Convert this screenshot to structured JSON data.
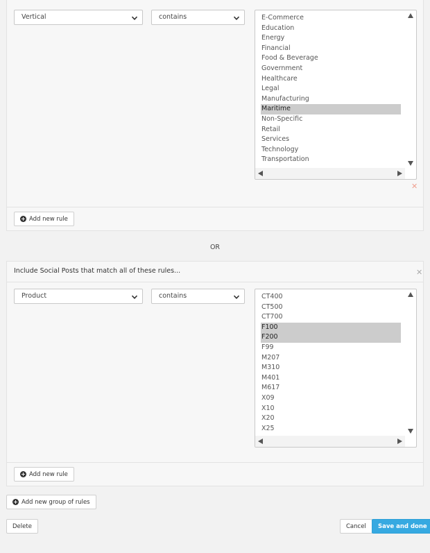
{
  "group1": {
    "rule": {
      "field": "Vertical",
      "operator": "contains",
      "options": [
        "E-Commerce",
        "Education",
        "Energy",
        "Financial",
        "Food & Beverage",
        "Government",
        "Healthcare",
        "Legal",
        "Manufacturing",
        "Maritime",
        "Non-Specific",
        "Retail",
        "Services",
        "Technology",
        "Transportation"
      ],
      "selected": [
        "Maritime"
      ],
      "remove_rule_icon": "close-icon"
    },
    "add_rule_label": "Add new rule"
  },
  "or_label": "OR",
  "group2": {
    "title": "Include Social Posts that match all of these rules...",
    "remove_group_icon": "close-icon",
    "rule": {
      "field": "Product",
      "operator": "contains",
      "options": [
        "CT400",
        "CT500",
        "CT700",
        "F100",
        "F200",
        "F99",
        "M207",
        "M310",
        "M401",
        "M617",
        "X09",
        "X10",
        "X20",
        "X25"
      ],
      "selected": [
        "F100",
        "F200"
      ]
    },
    "add_rule_label": "Add new rule"
  },
  "add_group_label": "Add new group of rules",
  "footer": {
    "delete_label": "Delete",
    "cancel_label": "Cancel",
    "save_label": "Save and done"
  },
  "colors": {
    "primary": "#36a9e1",
    "selected_option": "#cccccc",
    "remove_rule_x": "#f0a090",
    "remove_group_x": "#aaaaaa"
  }
}
